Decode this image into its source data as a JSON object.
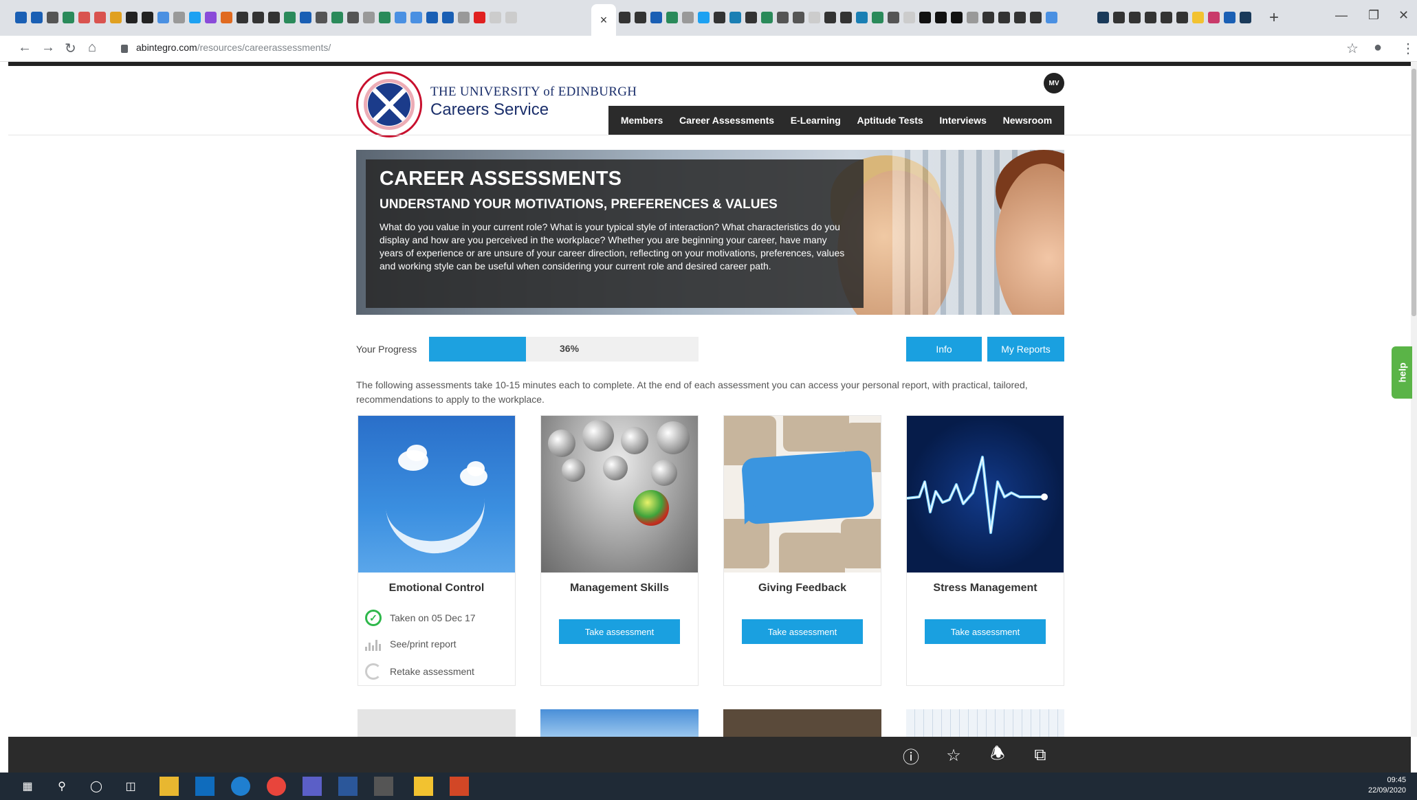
{
  "browser": {
    "url_host": "abintegro.com",
    "url_path": "/resources/careerassessments/",
    "new_tab": "+",
    "tab_close": "×"
  },
  "site": {
    "university": "THE UNIVERSITY of EDINBURGH",
    "service": "Careers Service",
    "user_initials": "MV",
    "nav": [
      "Members",
      "Career Assessments",
      "E-Learning",
      "Aptitude Tests",
      "Interviews",
      "Newsroom"
    ]
  },
  "hero": {
    "title": "CAREER ASSESSMENTS",
    "subtitle": "UNDERSTAND YOUR MOTIVATIONS, PREFERENCES & VALUES",
    "body": "What do you value in your current role? What is your typical style of interaction? What characteristics do you display and how are you perceived in the workplace? Whether you are beginning your career, have many years of experience or are unsure of your career direction, reflecting on your motivations, preferences, values and working style can be useful when considering your current role and desired career path."
  },
  "progress": {
    "label": "Your Progress",
    "percent": 36,
    "percent_text": "36%",
    "info_button": "Info",
    "reports_button": "My Reports"
  },
  "intro": "The following assessments take 10-15 minutes each to complete. At the end of each assessment you can access your personal report, with practical, tailored, recommendations to apply to the workplace.",
  "cards": [
    {
      "title": "Emotional Control",
      "taken": "Taken on 05 Dec 17",
      "report": "See/print report",
      "retake": "Retake assessment"
    },
    {
      "title": "Management Skills",
      "button": "Take assessment"
    },
    {
      "title": "Giving Feedback",
      "button": "Take assessment"
    },
    {
      "title": "Stress Management",
      "button": "Take assessment"
    }
  ],
  "help_tab": "help",
  "taskbar": {
    "time": "09:45",
    "date": "22/09/2020"
  },
  "colors": {
    "accent": "#1aa0e0",
    "nav_bg": "#2b2b2b",
    "brand_navy": "#1b2f6b",
    "check_green": "#2eb84b",
    "help_green": "#5ab447"
  }
}
